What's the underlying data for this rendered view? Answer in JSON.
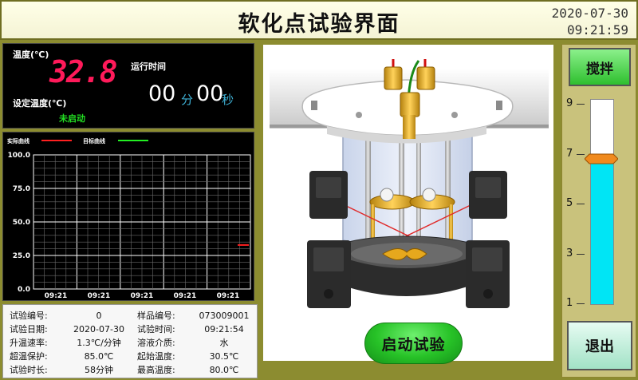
{
  "header": {
    "title": "软化点试验界面",
    "date": "2020-07-30",
    "time": "09:21:59"
  },
  "status": {
    "temp_label": "温度(℃)",
    "temp_value": "32.8",
    "set_temp_label": "设定温度(℃)",
    "run_state": "未启动",
    "run_time_label": "运行时间",
    "minutes": "00",
    "min_unit": "分",
    "seconds": "00",
    "sec_unit": "秒",
    "colors": {
      "temp_digits": "#ff1a5a",
      "run_state": "#22dd22",
      "units": "#3fb3d8"
    }
  },
  "chart": {
    "legend": [
      {
        "name": "实际曲线",
        "color": "#ff2020"
      },
      {
        "name": "目标曲线",
        "color": "#22ee22"
      }
    ]
  },
  "chart_data": {
    "type": "line",
    "y_tick_labels": [
      "100.0",
      "75.0",
      "50.0",
      "25.0",
      "0.0"
    ],
    "ylim": [
      0,
      100
    ],
    "x_tick_labels": [
      "09:21",
      "09:21",
      "09:21",
      "09:21",
      "09:21"
    ],
    "grid": true,
    "legend_position": "top-left",
    "series": [
      {
        "name": "实际曲线",
        "color": "#ff2020",
        "values": [
          32.8
        ]
      },
      {
        "name": "目标曲线",
        "color": "#22ee22",
        "values": []
      }
    ]
  },
  "info": {
    "rows": [
      {
        "k1": "试验编号:",
        "v1": "0",
        "k2": "样品编号:",
        "v2": "073009001"
      },
      {
        "k1": "试验日期:",
        "v1": "2020-07-30",
        "k2": "试验时间:",
        "v2": "09:21:54"
      },
      {
        "k1": "升温速率:",
        "v1": "1.3℃/分钟",
        "k2": "溶液介质:",
        "v2": "水"
      },
      {
        "k1": "超温保护:",
        "v1": "85.0℃",
        "k2": "起始温度:",
        "v2": "30.5℃"
      },
      {
        "k1": "试验时长:",
        "v1": "58分钟",
        "k2": "最高温度:",
        "v2": "80.0℃"
      }
    ]
  },
  "controls": {
    "start_label": "启动试验",
    "stir_label": "搅拌",
    "exit_label": "退出"
  },
  "gauge": {
    "labels": [
      "9",
      "7",
      "5",
      "3",
      "1"
    ],
    "min": 1,
    "max": 9,
    "level": 6.8,
    "fill_color": "#00e5f5"
  }
}
